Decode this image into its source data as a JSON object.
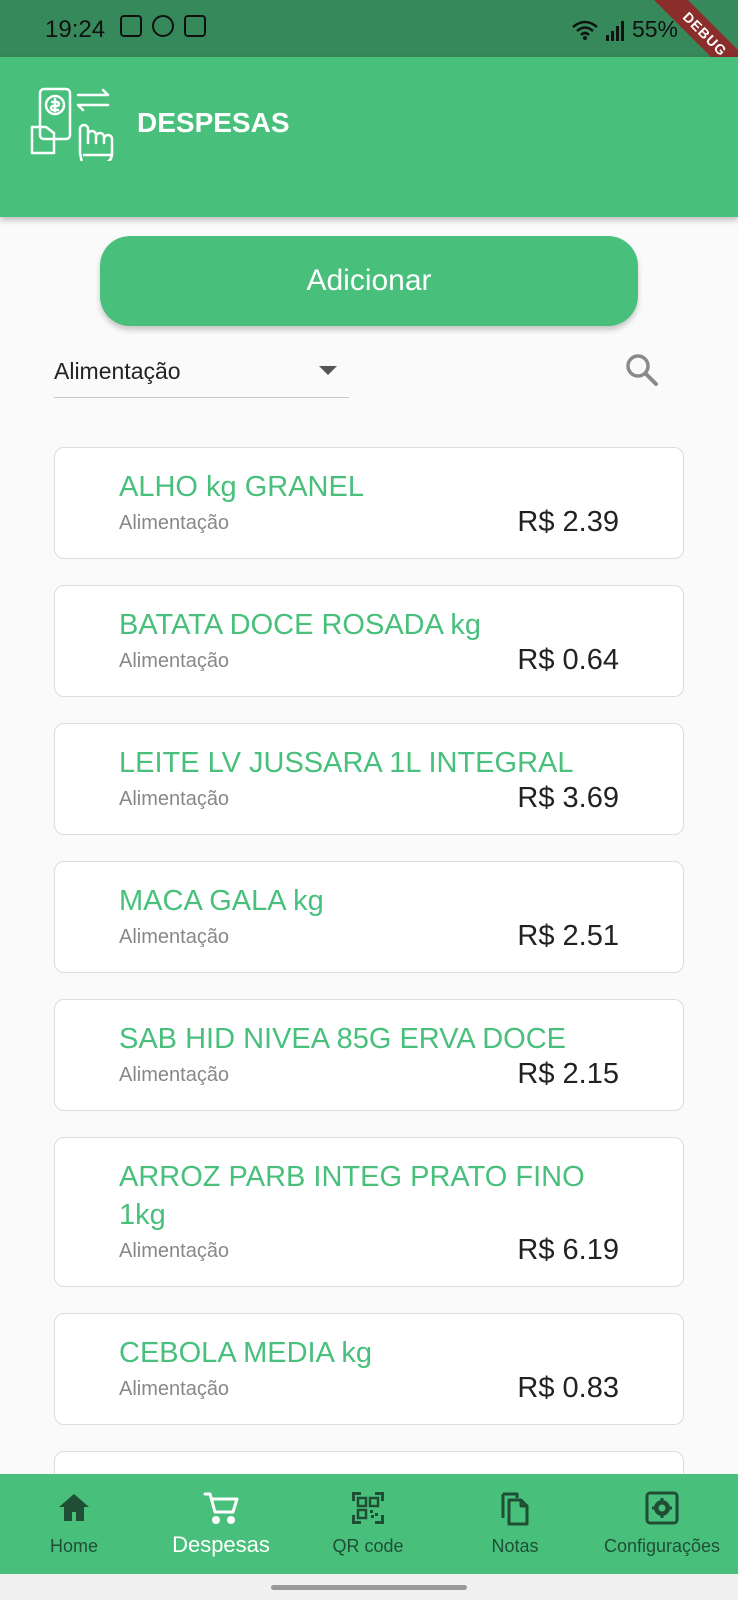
{
  "status_bar": {
    "time": "19:24",
    "battery": "55%",
    "icons": [
      "image-icon",
      "whatsapp-icon",
      "app-icon"
    ]
  },
  "debug_banner": "DEBUG",
  "app_bar": {
    "title": "DESPESAS",
    "logo": "expense-hand-icon"
  },
  "add_button_label": "Adicionar",
  "filter": {
    "selected": "Alimentação"
  },
  "expenses": [
    {
      "name": "ALHO kg GRANEL",
      "category": "Alimentação",
      "price": "R$ 2.39"
    },
    {
      "name": "BATATA DOCE ROSADA kg",
      "category": "Alimentação",
      "price": "R$ 0.64"
    },
    {
      "name": "LEITE LV JUSSARA 1L INTEGRAL",
      "category": "Alimentação",
      "price": "R$ 3.69"
    },
    {
      "name": "MACA GALA kg",
      "category": "Alimentação",
      "price": "R$ 2.51"
    },
    {
      "name": "SAB HID NIVEA 85G ERVA DOCE",
      "category": "Alimentação",
      "price": "R$ 2.15"
    },
    {
      "name": "ARROZ PARB INTEG PRATO FINO 1kg",
      "category": "Alimentação",
      "price": "R$ 6.19"
    },
    {
      "name": "CEBOLA MEDIA kg",
      "category": "Alimentação",
      "price": "R$ 0.83"
    }
  ],
  "bottom_nav": [
    {
      "label": "Home",
      "icon": "home-icon",
      "active": false
    },
    {
      "label": "Despesas",
      "icon": "cart-icon",
      "active": true
    },
    {
      "label": "QR code",
      "icon": "qr-code-icon",
      "active": false
    },
    {
      "label": "Notas",
      "icon": "copy-icon",
      "active": false
    },
    {
      "label": "Configurações",
      "icon": "settings-icon",
      "active": false
    }
  ]
}
